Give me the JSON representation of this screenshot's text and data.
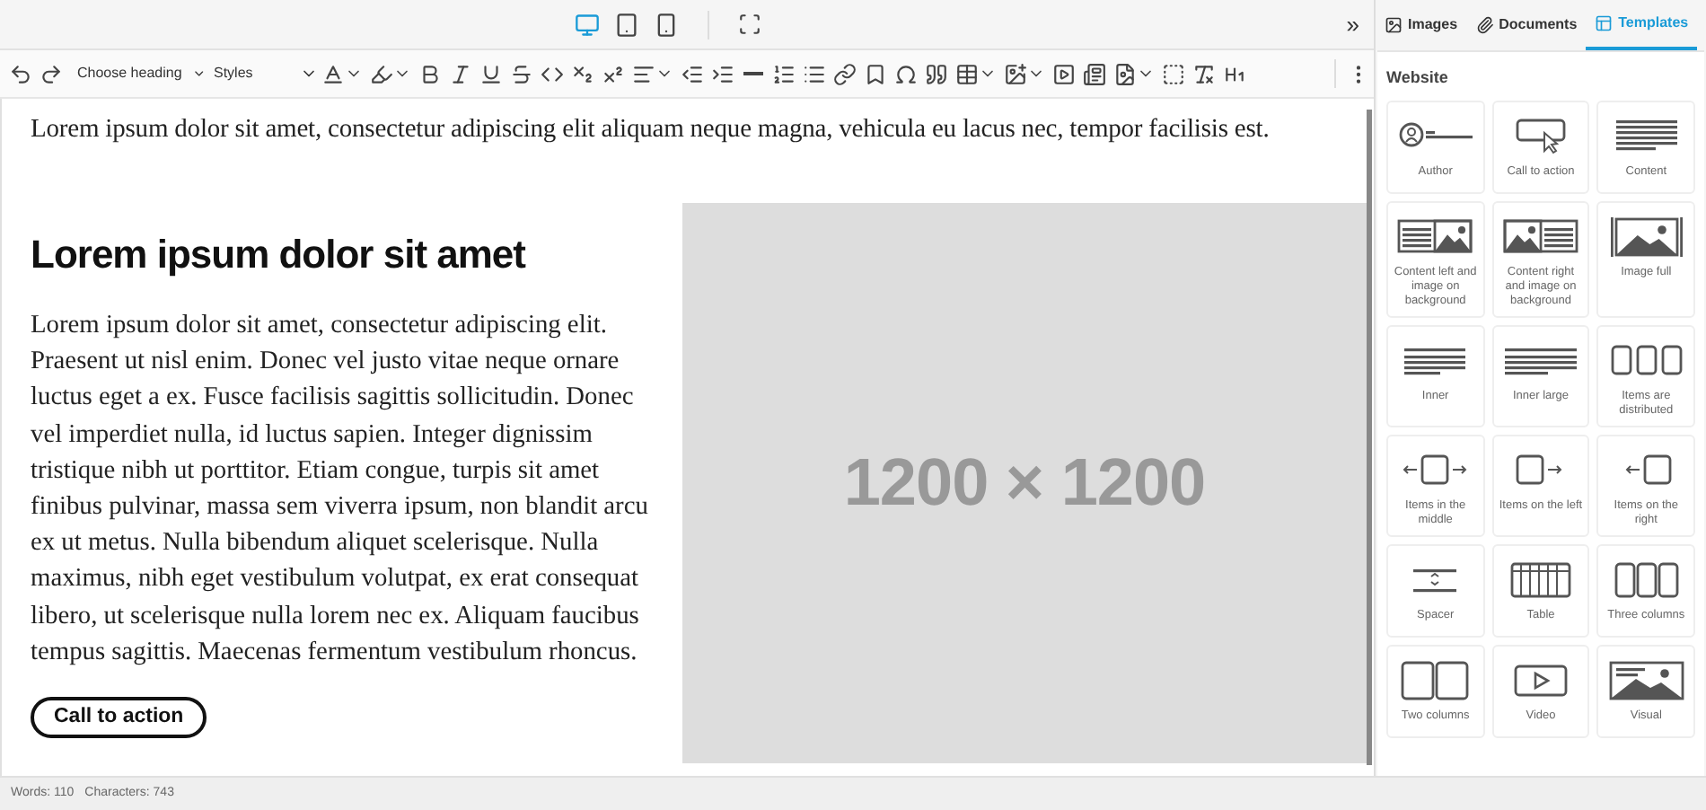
{
  "top_bar": {
    "devices": [
      {
        "kind": "desktop",
        "selected": true
      },
      {
        "kind": "tablet",
        "selected": false
      },
      {
        "kind": "phone",
        "selected": false
      }
    ],
    "collapse": "»"
  },
  "panel_tabs": [
    {
      "label": "Images",
      "kind": "images",
      "selected": false
    },
    {
      "label": "Documents",
      "kind": "documents",
      "selected": false
    },
    {
      "label": "Templates",
      "kind": "templates",
      "selected": true
    }
  ],
  "toolbar": {
    "heading_select": "Choose heading",
    "styles_select": "Styles"
  },
  "content": {
    "intro": "Lorem ipsum dolor sit amet, consectetur adipiscing elit aliquam neque magna, vehicula eu lacus nec, tempor facilisis est.",
    "heading": "Lorem ipsum dolor sit amet",
    "body": "Lorem ipsum dolor sit amet, consectetur adipiscing elit. Praesent ut nisl enim. Donec vel justo vitae neque ornare luctus eget a ex. Fusce facilisis sagittis sollicitudin. Donec vel imperdiet nulla, id luctus sapien. Integer dignissim tristique nibh ut porttitor. Etiam congue, turpis sit amet finibus pulvinar, massa sem viverra ipsum, non blandit arcu ex ut metus. Nulla bibendum aliquet scelerisque. Nulla maximus, nibh eget vestibulum volutpat, ex erat consequat libero, ut scelerisque nulla lorem nec ex. Aliquam faucibus tempus sagittis. Maecenas fermentum vestibulum rhoncus.",
    "button": "Call to action",
    "image_placeholder": "1200 × 1200"
  },
  "templates": {
    "section": "Website",
    "items": [
      {
        "label": "Author",
        "kind": "author"
      },
      {
        "label": "Call to action",
        "kind": "cta"
      },
      {
        "label": "Content",
        "kind": "content"
      },
      {
        "label": "Content left and image on background",
        "kind": "content-left"
      },
      {
        "label": "Content right and image on background",
        "kind": "content-right"
      },
      {
        "label": "Image full",
        "kind": "image-full"
      },
      {
        "label": "Inner",
        "kind": "inner"
      },
      {
        "label": "Inner large",
        "kind": "inner-large"
      },
      {
        "label": "Items are distributed",
        "kind": "distributed"
      },
      {
        "label": "Items in the middle",
        "kind": "middle"
      },
      {
        "label": "Items on the left",
        "kind": "left"
      },
      {
        "label": "Items on the right",
        "kind": "right"
      },
      {
        "label": "Spacer",
        "kind": "spacer"
      },
      {
        "label": "Table",
        "kind": "table"
      },
      {
        "label": "Three columns",
        "kind": "three-columns"
      },
      {
        "label": "Two columns",
        "kind": "two-columns"
      },
      {
        "label": "Video",
        "kind": "video"
      },
      {
        "label": "Visual",
        "kind": "visual"
      }
    ]
  },
  "status_bar": {
    "words": "Words: 110",
    "characters": "Characters: 743"
  }
}
